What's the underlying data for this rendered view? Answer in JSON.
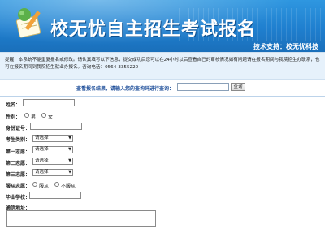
{
  "header": {
    "title": "校无忧自主招生考试报名",
    "support": "技术支持：校无忧科技"
  },
  "notice": {
    "text": "提醒：本系统不能重复报名或修改。请认真填写以下信息，提交成功后您可以在24小时以后查看自己的审核情况如有问题请在报名期间与我院招生办联系，也可在报名期间到我院招生就业办报名。咨询电话：0564-3355220"
  },
  "query": {
    "label": "查看报名结果，请输入您的查询码进行查询：",
    "input_value": "",
    "button_label": "查询"
  },
  "form": {
    "name_label": "姓名：",
    "gender_label": "性别：",
    "gender_options": [
      "男",
      "女"
    ],
    "id_label": "身份证号：",
    "category_label": "考生类别：",
    "choice1_label": "第一志愿：",
    "choice2_label": "第二志愿：",
    "choice3_label": "第三志愿：",
    "select_placeholder": "请选择",
    "adjust_label": "服从志愿：",
    "adjust_options": [
      "服从",
      "不服从"
    ],
    "school_label": "毕业学校：",
    "address_label": "通信地址："
  },
  "colors": {
    "banner": "#1f7fcf",
    "notice_bg": "#e6f1fb",
    "query_label": "#1f4f9a"
  }
}
